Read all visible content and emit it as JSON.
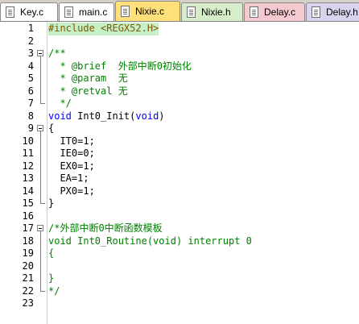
{
  "tabs": [
    {
      "label": "Key.c",
      "color": "#ffffff"
    },
    {
      "label": "main.c",
      "color": "#ffffff"
    },
    {
      "label": "Nixie.c",
      "color": "#ffe07a",
      "active": true
    },
    {
      "label": "Nixie.h",
      "color": "#d7ecc8"
    },
    {
      "label": "Delay.c",
      "color": "#f4c9cf"
    },
    {
      "label": "Delay.h",
      "color": "#d9d3ee"
    }
  ],
  "lines": [
    {
      "n": "1",
      "text": "#include <REGX52.H>"
    },
    {
      "n": "2",
      "text": ""
    },
    {
      "n": "3",
      "text": "/**"
    },
    {
      "n": "4",
      "text": "  * @brief  外部中断0初始化"
    },
    {
      "n": "5",
      "text": "  * @param  无"
    },
    {
      "n": "6",
      "text": "  * @retval 无"
    },
    {
      "n": "7",
      "text": "  */"
    },
    {
      "n": "8",
      "text": "void Int0_Init(void)"
    },
    {
      "n": "9",
      "text": "{"
    },
    {
      "n": "10",
      "text": "  IT0=1;"
    },
    {
      "n": "11",
      "text": "  IE0=0;"
    },
    {
      "n": "12",
      "text": "  EX0=1;"
    },
    {
      "n": "13",
      "text": "  EA=1;"
    },
    {
      "n": "14",
      "text": "  PX0=1;"
    },
    {
      "n": "15",
      "text": "}"
    },
    {
      "n": "16",
      "text": ""
    },
    {
      "n": "17",
      "text": "/*外部中断0中断函数模板"
    },
    {
      "n": "18",
      "text": "void Int0_Routine(void) interrupt 0"
    },
    {
      "n": "19",
      "text": "{"
    },
    {
      "n": "20",
      "text": ""
    },
    {
      "n": "21",
      "text": "}"
    },
    {
      "n": "22",
      "text": "*/"
    },
    {
      "n": "23",
      "text": ""
    }
  ],
  "folds": {
    "3": "open",
    "4": "line",
    "5": "line",
    "6": "line",
    "7": "end",
    "9": "open",
    "10": "line",
    "11": "line",
    "12": "line",
    "13": "line",
    "14": "line",
    "15": "end",
    "17": "open",
    "18": "line",
    "19": "line",
    "20": "line",
    "21": "line",
    "22": "end"
  },
  "syntax": {
    "comment_color": "#008000",
    "keyword_color": "#0000ff",
    "preprocessor_color": "#7a5a00",
    "current_line_bg": "#c8f0c8"
  }
}
